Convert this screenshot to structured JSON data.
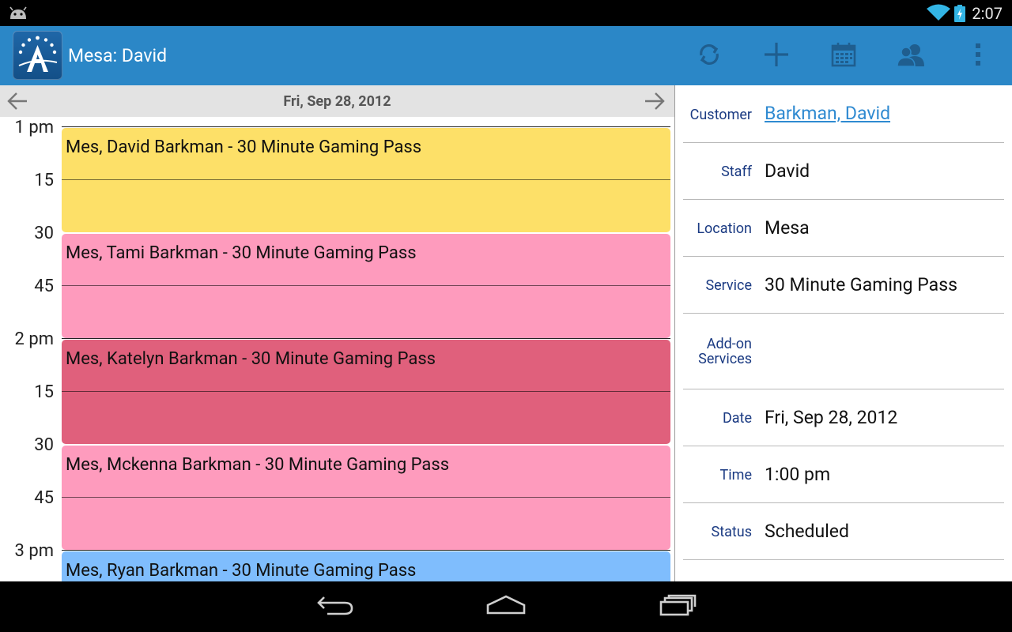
{
  "status_bar": {
    "time": "2:07"
  },
  "action_bar": {
    "title": "Mesa: David",
    "actions": [
      "refresh-icon",
      "add-icon",
      "calendar-icon",
      "people-icon",
      "overflow-menu-icon"
    ]
  },
  "calendar": {
    "date": "Fri, Sep 28, 2012",
    "time_labels": [
      "1 pm",
      "15",
      "30",
      "45",
      "2 pm",
      "15",
      "30",
      "45",
      "3 pm"
    ],
    "appointments": [
      {
        "text": "Mes, David Barkman - 30 Minute Gaming Pass",
        "color": "#fde068"
      },
      {
        "text": "Mes, Tami Barkman - 30 Minute Gaming Pass",
        "color": "#fe9bbd"
      },
      {
        "text": "Mes, Katelyn Barkman - 30 Minute Gaming Pass",
        "color": "#e0607c"
      },
      {
        "text": "Mes, Mckenna Barkman - 30 Minute Gaming Pass",
        "color": "#fe9bbd"
      },
      {
        "text": "Mes, Ryan Barkman - 30 Minute Gaming Pass",
        "color": "#7fbdfd"
      }
    ]
  },
  "details": {
    "customer_label": "Customer",
    "customer_value": "Barkman, David",
    "staff_label": "Staff",
    "staff_value": "David",
    "location_label": "Location",
    "location_value": "Mesa",
    "service_label": "Service",
    "service_value": "30 Minute Gaming Pass",
    "addon_label_1": "Add-on",
    "addon_label_2": "Services",
    "addon_value": "",
    "date_label": "Date",
    "date_value": "Fri, Sep 28, 2012",
    "time_label": "Time",
    "time_value": "1:00 pm",
    "status_label": "Status",
    "status_value": "Scheduled"
  },
  "colors": {
    "action_bar": "#2b87c7",
    "link": "#2f8ad1",
    "label": "#1a3a82"
  }
}
